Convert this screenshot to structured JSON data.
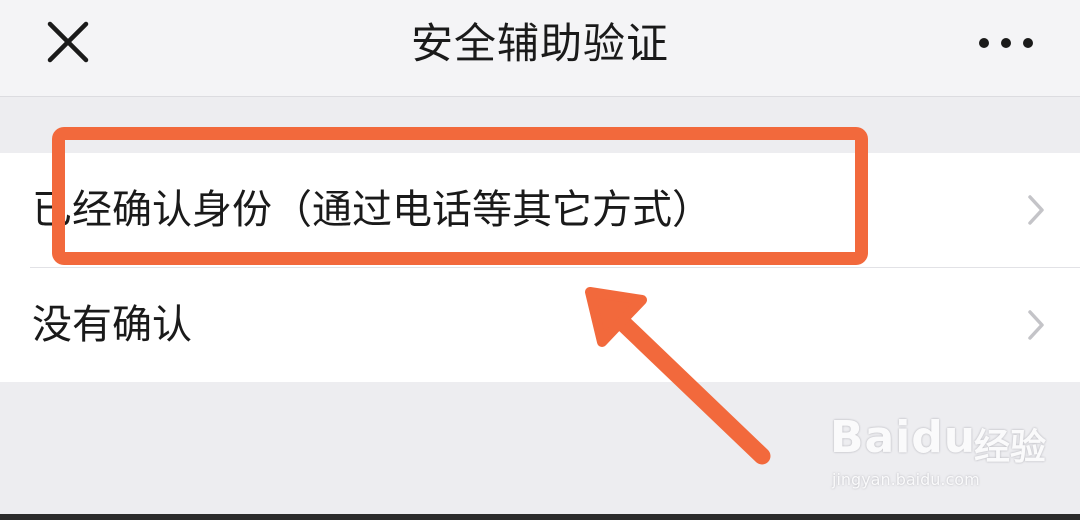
{
  "header": {
    "title": "安全辅助验证",
    "close_icon": "close-icon",
    "more_icon": "more-icon"
  },
  "options": [
    {
      "label": "已经确认身份（通过电话等其它方式）",
      "icon": "chevron-right-icon"
    },
    {
      "label": "没有确认",
      "icon": "chevron-right-icon"
    }
  ],
  "annotation": {
    "color": "#f2693c"
  },
  "watermark": {
    "brand": "Baidu",
    "cn": "经验",
    "url": "jingyan.baidu.com"
  },
  "colors": {
    "background": "#ededf0",
    "header": "#f4f4f6",
    "list_background": "#ffffff",
    "text": "#1a1a1a",
    "chevron": "#c4c4c8"
  }
}
